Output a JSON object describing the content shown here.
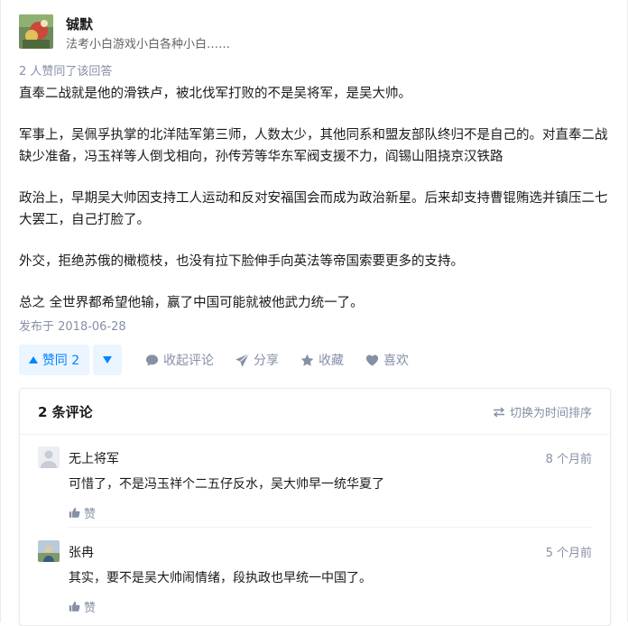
{
  "author": {
    "name": "铖默",
    "bio": "法考小白游戏小白各种小白……"
  },
  "votes_line": "2 人赞同了该回答",
  "answer": {
    "paragraphs": [
      "直奉二战就是他的滑铁卢，被北伐军打败的不是吴将军，是吴大帅。",
      "军事上，吴佩孚执掌的北洋陆军第三师，人数太少，其他同系和盟友部队终归不是自己的。对直奉二战缺少准备，冯玉祥等人倒戈相向，孙传芳等华东军阀支援不力，阎锡山阻挠京汉铁路",
      "政治上，早期吴大帅因支持工人运动和反对安福国会而成为政治新星。后来却支持曹锟贿选并镇压二七大罢工，自己打脸了。",
      "外交，拒绝苏俄的橄榄枝，也没有拉下脸伸手向英法等帝国索要更多的支持。",
      "总之 全世界都希望他输，赢了中国可能就被他武力统一了。"
    ],
    "published": "发布于 2018-06-28"
  },
  "actions": {
    "vote_up_label": "赞同 2",
    "collapse_comments": "收起评论",
    "share": "分享",
    "favorite": "收藏",
    "like": "喜欢"
  },
  "comments": {
    "title": "2 条评论",
    "sort_toggle": "切换为时间排序",
    "items": [
      {
        "author": "无上将军",
        "time": "8 个月前",
        "text": "可惜了，不是冯玉祥个二五仔反水，吴大帅早一统华夏了",
        "like_label": "赞"
      },
      {
        "author": "张冉",
        "time": "5 个月前",
        "text": "其实，要不是吴大帅闹情绪，段执政也早统一中国了。",
        "like_label": "赞"
      }
    ]
  },
  "colors": {
    "accent": "#0084ff",
    "accent_bg": "#ebf5ff",
    "muted": "#8590a6",
    "text": "#1a1a1a"
  }
}
